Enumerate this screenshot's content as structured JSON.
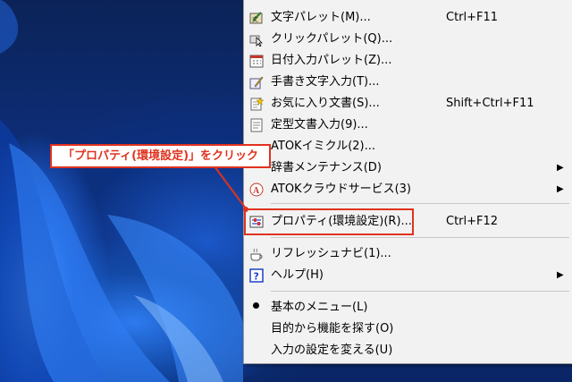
{
  "colors": {
    "accent": "#e0321e",
    "menu_bg": "#f2f2f2"
  },
  "callout": {
    "text": "「プロパティ(環境設定)」をクリック"
  },
  "menu": {
    "items": [
      {
        "label": "文字パレット(M)...",
        "shortcut": "Ctrl+F11",
        "icon": "character-palette-icon"
      },
      {
        "label": "クリックパレット(Q)...",
        "shortcut": "",
        "icon": "click-palette-icon"
      },
      {
        "label": "日付入力パレット(Z)...",
        "shortcut": "",
        "icon": "calendar-icon"
      },
      {
        "label": "手書き文字入力(T)...",
        "shortcut": "",
        "icon": "handwriting-icon"
      },
      {
        "label": "お気に入り文書(S)...",
        "shortcut": "Shift+Ctrl+F11",
        "icon": "favorite-doc-icon"
      },
      {
        "label": "定型文書入力(9)...",
        "shortcut": "",
        "icon": "template-doc-icon"
      },
      {
        "label": "ATOKイミクル(2)...",
        "shortcut": "",
        "icon": ""
      },
      {
        "label": "辞書メンテナンス(D)",
        "shortcut": "",
        "icon": ""
      },
      {
        "label": "ATOKクラウドサービス(3)",
        "shortcut": "",
        "icon": "atok-cloud-icon"
      },
      {
        "label": "プロパティ(環境設定)(R)...",
        "shortcut": "Ctrl+F12",
        "icon": "properties-icon"
      },
      {
        "label": "リフレッシュナビ(1)...",
        "shortcut": "",
        "icon": "coffee-cup-icon"
      },
      {
        "label": "ヘルプ(H)",
        "shortcut": "",
        "icon": "help-icon"
      },
      {
        "label": "基本のメニュー(L)",
        "shortcut": "",
        "icon": "bullet-icon"
      },
      {
        "label": "目的から機能を探す(O)",
        "shortcut": "",
        "icon": ""
      },
      {
        "label": "入力の設定を変える(U)",
        "shortcut": "",
        "icon": ""
      }
    ]
  }
}
